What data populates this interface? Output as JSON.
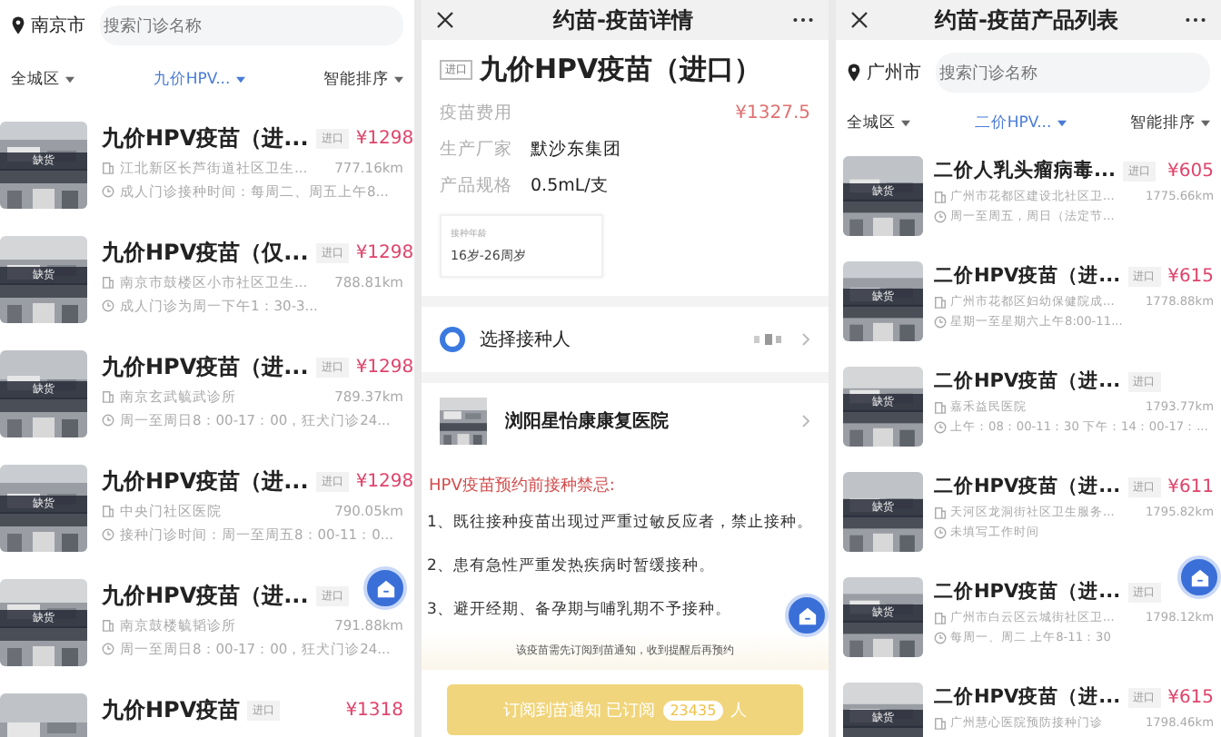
{
  "screens": [
    {
      "kind": "list",
      "location": "南京市",
      "search_placeholder": "搜索门诊名称",
      "filters": [
        {
          "label": "全城区",
          "selected": false
        },
        {
          "label": "九价HPV...",
          "selected": true
        },
        {
          "label": "智能排序",
          "selected": false
        }
      ],
      "items": [
        {
          "title": "九价HPV疫苗（进...",
          "tag": "进口",
          "price": "¥1298",
          "badge": "缺货",
          "address": "江北新区长芦街道社区卫生...",
          "distance": "777.16km",
          "hours": "成人门诊接种时间：每周二、周五上午8..."
        },
        {
          "title": "九价HPV疫苗（仅...",
          "tag": "进口",
          "price": "¥1298",
          "badge": "缺货",
          "address": "南京市鼓楼区小市社区卫生...",
          "distance": "788.81km",
          "hours": "成人门诊为周一下午1：30-3..."
        },
        {
          "title": "九价HPV疫苗（进...",
          "tag": "进口",
          "price": "¥1298",
          "badge": "缺货",
          "address": "南京玄武毓武诊所",
          "distance": "789.37km",
          "hours": "周一至周日8：00-17：00，狂犬门诊24..."
        },
        {
          "title": "九价HPV疫苗（进...",
          "tag": "进口",
          "price": "¥1298",
          "badge": "缺货",
          "address": "中央门社区医院",
          "distance": "790.05km",
          "hours": "接种门诊时间：周一至周五8：00-11：0..."
        },
        {
          "title": "九价HPV疫苗（进...",
          "tag": "进口",
          "badge": "缺货",
          "address": "南京鼓楼毓韬诊所",
          "distance": "791.88km",
          "hours": "周一至周日8：00-17：00，狂犬门诊24..."
        },
        {
          "title": "九价HPV疫苗",
          "tag": "进口",
          "price": "¥1318"
        }
      ]
    },
    {
      "kind": "detail",
      "title": "约苗-疫苗详情",
      "tag": "进口",
      "product": "九价HPV疫苗（进口）",
      "fields": [
        {
          "label": "疫苗费用",
          "value": "¥1327.5",
          "kind": "price"
        },
        {
          "label": "生产厂家",
          "value": "默沙东集团",
          "kind": "text"
        },
        {
          "label": "产品规格",
          "value": "0.5mL/支",
          "kind": "text"
        }
      ],
      "age": {
        "label": "接种年龄",
        "value": "16岁-26周岁"
      },
      "person_row": "选择接种人",
      "hospital": "浏阳星怡康康复医院",
      "warning_title": "HPV疫苗预约前接种禁忌:",
      "warnings": [
        "1、既往接种疫苗出现过严重过敏反应者，禁止接种。",
        "2、患有急性严重发热疾病时暂缓接种。",
        "3、避开经期、备孕期与哺乳期不予接种。"
      ],
      "notice": "该疫苗需先订阅到苗通知，收到提醒后再预约",
      "button": {
        "label": "订阅到苗通知  已订阅",
        "count": "23435",
        "unit": "人"
      }
    },
    {
      "kind": "list",
      "title": "约苗-疫苗产品列表",
      "location": "广州市",
      "search_placeholder": "搜索门诊名称",
      "filters": [
        {
          "label": "全城区",
          "selected": false
        },
        {
          "label": "二价HPV...",
          "selected": true
        },
        {
          "label": "智能排序",
          "selected": false
        }
      ],
      "items": [
        {
          "title": "二价人乳头瘤病毒...",
          "tag": "进口",
          "price": "¥605",
          "badge": "缺货",
          "address": "广州市花都区建设北社区卫...",
          "distance": "1775.66km",
          "hours": "周一至周五，周日（法定节..."
        },
        {
          "title": "二价HPV疫苗（进...",
          "tag": "进口",
          "price": "¥615",
          "badge": "缺货",
          "address": "广州市花都区妇幼保健院成...",
          "distance": "1778.88km",
          "hours": "星期一至星期六上午8:00-11..."
        },
        {
          "title": "二价HPV疫苗（进...",
          "tag": "进口",
          "badge": "缺货",
          "address": "嘉禾益民医院",
          "distance": "1793.77km",
          "hours": "上午：08：00-11：30 下午：14：00-17：..."
        },
        {
          "title": "二价HPV疫苗（进...",
          "tag": "进口",
          "price": "¥611",
          "badge": "缺货",
          "address": "天河区龙洞街社区卫生服务...",
          "distance": "1795.82km",
          "hours": "未填写工作时间"
        },
        {
          "title": "二价HPV疫苗（进...",
          "tag": "进口",
          "badge": "缺货",
          "address": "广州市白云区云城街社区卫...",
          "distance": "1798.12km",
          "hours": "每周一、周二 上午8-11：30"
        },
        {
          "title": "二价HPV疫苗（进...",
          "tag": "进口",
          "price": "¥615",
          "badge": "缺货",
          "address": "广州慧心医院预防接种门诊",
          "distance": "1798.46km"
        }
      ]
    }
  ]
}
